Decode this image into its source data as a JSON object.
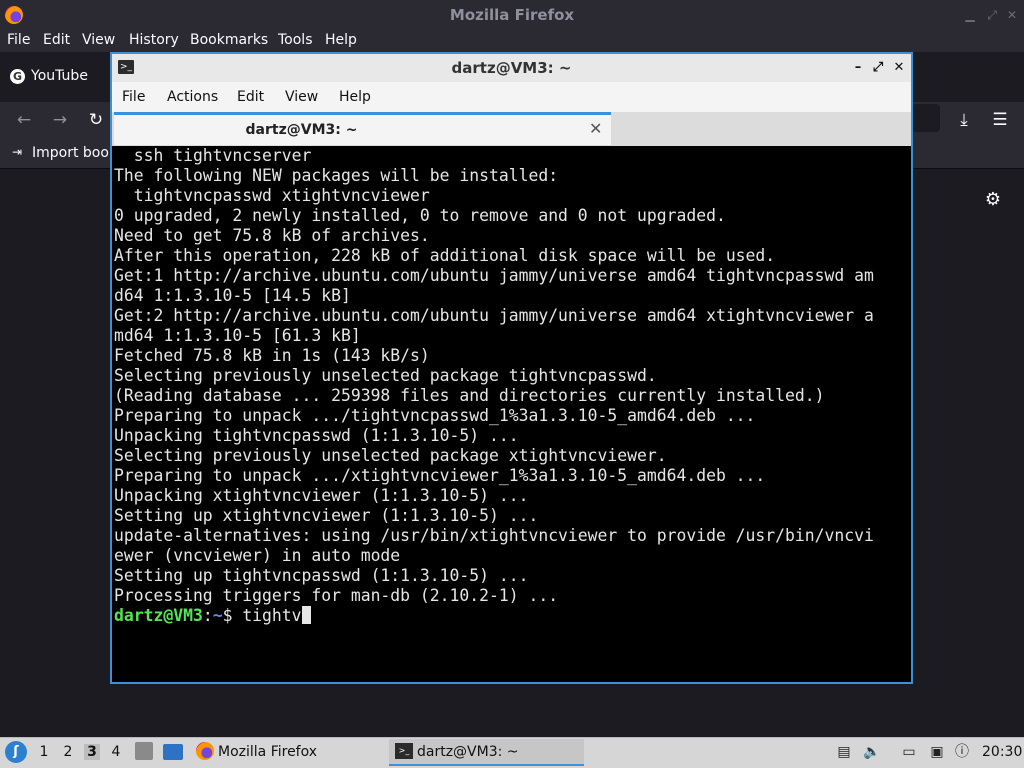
{
  "firefox": {
    "window_title": "Mozilla Firefox",
    "menu": [
      "File",
      "Edit",
      "View",
      "History",
      "Bookmarks",
      "Tools",
      "Help"
    ],
    "tab_label": "YouTube",
    "tab_favicon_letter": "G",
    "bookmarks_import_label": "Import book"
  },
  "terminal": {
    "window_title": "dartz@VM3: ~",
    "menu": [
      "File",
      "Actions",
      "Edit",
      "View",
      "Help"
    ],
    "tab_label": "dartz@VM3: ~",
    "lines": [
      "  ssh tightvncserver",
      "The following NEW packages will be installed:",
      "  tightvncpasswd xtightvncviewer",
      "0 upgraded, 2 newly installed, 0 to remove and 0 not upgraded.",
      "Need to get 75.8 kB of archives.",
      "After this operation, 228 kB of additional disk space will be used.",
      "Get:1 http://archive.ubuntu.com/ubuntu jammy/universe amd64 tightvncpasswd am",
      "d64 1:1.3.10-5 [14.5 kB]",
      "Get:2 http://archive.ubuntu.com/ubuntu jammy/universe amd64 xtightvncviewer a",
      "md64 1:1.3.10-5 [61.3 kB]",
      "Fetched 75.8 kB in 1s (143 kB/s)",
      "Selecting previously unselected package tightvncpasswd.",
      "(Reading database ... 259398 files and directories currently installed.)",
      "Preparing to unpack .../tightvncpasswd_1%3a1.3.10-5_amd64.deb ...",
      "Unpacking tightvncpasswd (1:1.3.10-5) ...",
      "Selecting previously unselected package xtightvncviewer.",
      "Preparing to unpack .../xtightvncviewer_1%3a1.3.10-5_amd64.deb ...",
      "Unpacking xtightvncviewer (1:1.3.10-5) ...",
      "Setting up xtightvncviewer (1:1.3.10-5) ...",
      "update-alternatives: using /usr/bin/xtightvncviewer to provide /usr/bin/vncvi",
      "ewer (vncviewer) in auto mode",
      "Setting up tightvncpasswd (1:1.3.10-5) ...",
      "Processing triggers for man-db (2.10.2-1) ..."
    ],
    "prompt": {
      "user_host": "dartz@VM3",
      "sep": ":",
      "path": "~",
      "symbol": "$ ",
      "input": "tightv"
    }
  },
  "taskbar": {
    "workspaces": [
      "1",
      "2",
      "3",
      "4"
    ],
    "active_workspace": "3",
    "tasks": [
      {
        "label": "Mozilla Firefox",
        "icon": "firefox-icon"
      },
      {
        "label": "dartz@VM3: ~",
        "icon": "terminal-icon"
      }
    ],
    "clock": "20:30"
  },
  "colors": {
    "accent": "#3d8fd6",
    "prompt_user": "#55e655",
    "prompt_path": "#5a8ff0",
    "firefox_bg": "#1c1b22",
    "terminal_bg": "#000000"
  }
}
